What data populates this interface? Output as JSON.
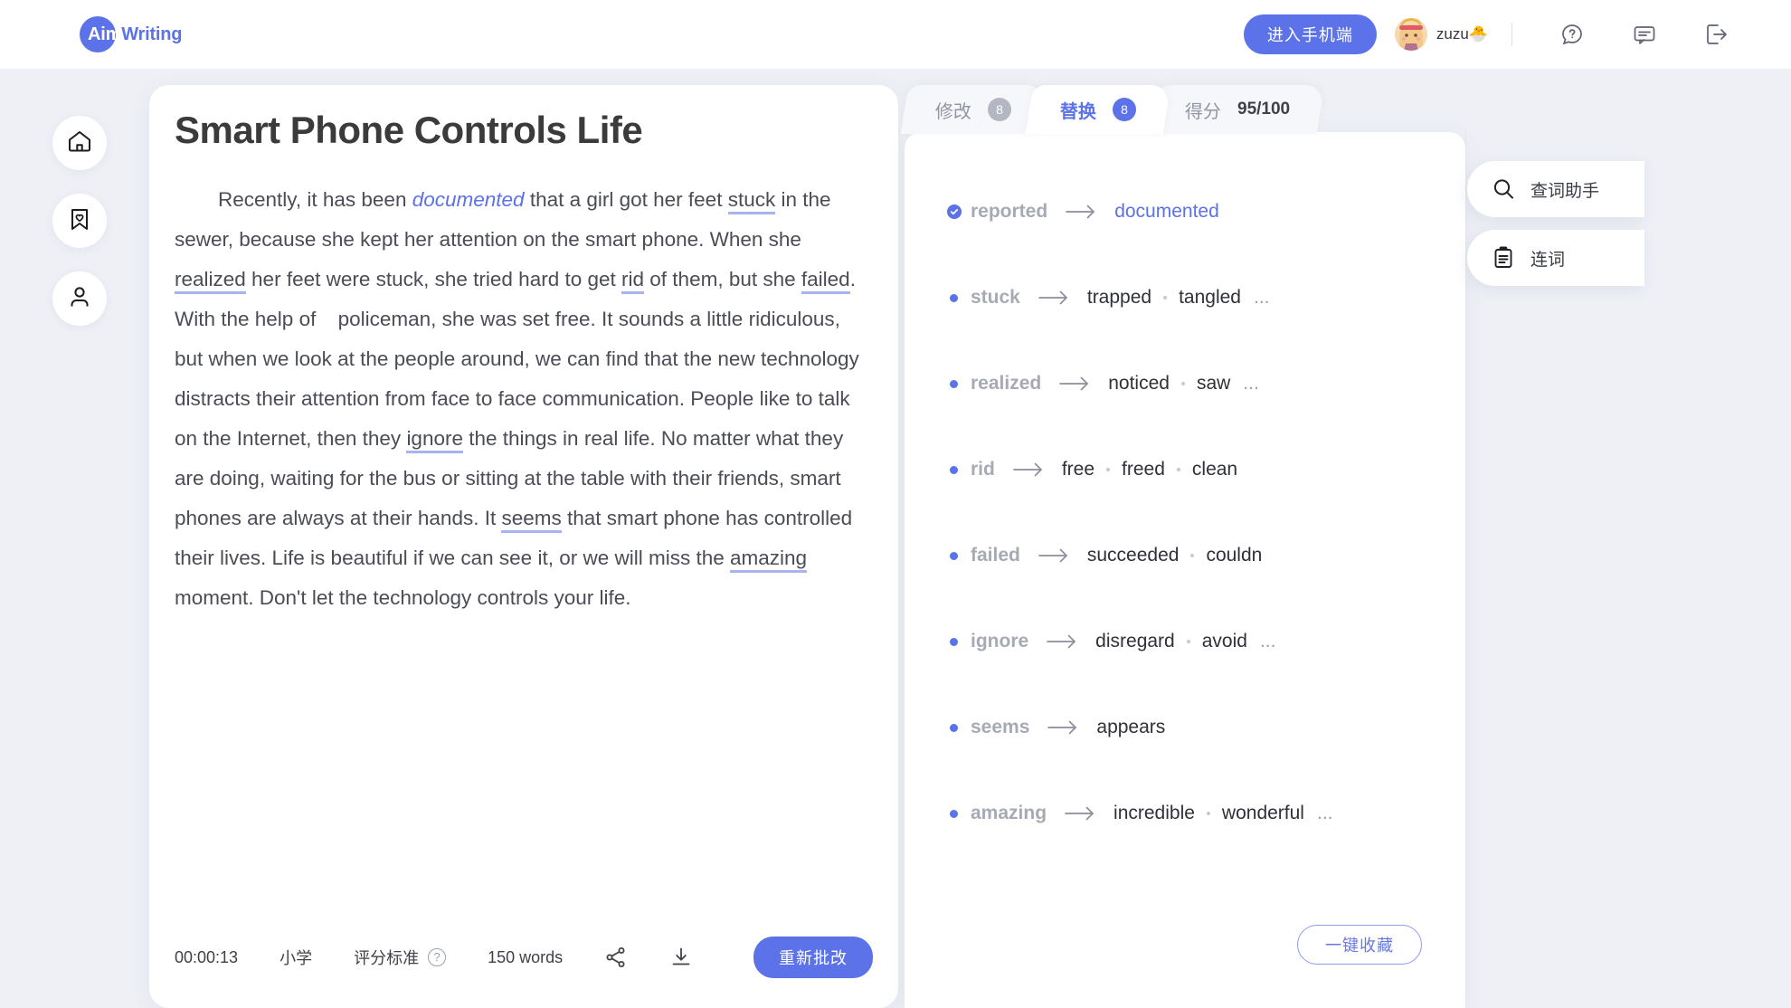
{
  "header": {
    "logo": {
      "part1": "Aim",
      "part2": "Writing"
    },
    "mobile_button": "进入手机端",
    "user_name": "zuzu🐣",
    "icons": [
      "help-icon",
      "feedback-icon",
      "logout-icon"
    ]
  },
  "sidebar": {
    "items": [
      {
        "name": "home",
        "icon": "home-icon"
      },
      {
        "name": "favorites",
        "icon": "bookmark-heart-icon"
      },
      {
        "name": "profile",
        "icon": "user-icon"
      }
    ]
  },
  "essay": {
    "title": "Smart Phone Controls Life",
    "paragraph": [
      {
        "text": "Recently, it has been ",
        "style": "normal"
      },
      {
        "text": "documented",
        "style": "replaced"
      },
      {
        "text": " that a girl got her feet ",
        "style": "normal"
      },
      {
        "text": "stuck",
        "style": "underline"
      },
      {
        "text": " in the sewer, because she kept her attention on the smart phone. When she ",
        "style": "normal"
      },
      {
        "text": "realized",
        "style": "underline"
      },
      {
        "text": " her feet were stuck, she tried hard to get ",
        "style": "normal"
      },
      {
        "text": "rid",
        "style": "underline"
      },
      {
        "text": " of them, but she ",
        "style": "normal"
      },
      {
        "text": "failed",
        "style": "underline"
      },
      {
        "text": ". With the help of",
        "style": "normal"
      },
      {
        "text": "",
        "style": "gap"
      },
      {
        "text": " policeman, she was set free. It sounds a little ridiculous, but when we look at the people around, we can find that the new technology distracts their attention from face to face communication. People like to talk on the Internet, then they ",
        "style": "normal"
      },
      {
        "text": "ignore",
        "style": "underline"
      },
      {
        "text": " the things in real life. No matter what they are doing, waiting for the bus or sitting at the table with their friends, smart phones are always at their hands. It ",
        "style": "normal"
      },
      {
        "text": "seems",
        "style": "underline"
      },
      {
        "text": " that smart phone has controlled their lives. Life is beautiful if we can see it, or we will miss the ",
        "style": "normal"
      },
      {
        "text": "amazing",
        "style": "underline"
      },
      {
        "text": " moment. Don't let the technology controls your life.",
        "style": "normal"
      }
    ],
    "footer": {
      "timer": "00:00:13",
      "level": "小学",
      "rubric": "评分标准",
      "word_count": "150 words",
      "share_icon": "share-icon",
      "download_icon": "download-icon",
      "redo_button": "重新批改"
    }
  },
  "tabs": [
    {
      "label": "修改",
      "badge": "8",
      "active": false
    },
    {
      "label": "替换",
      "badge": "8",
      "active": true
    },
    {
      "label": "得分",
      "score": "95/100",
      "active": false
    }
  ],
  "suggestions": [
    {
      "marker": "check",
      "original": "reported",
      "candidates": [
        "documented"
      ],
      "applied_index": 0,
      "more": false
    },
    {
      "marker": "dot",
      "original": "stuck",
      "candidates": [
        "trapped",
        "tangled"
      ],
      "applied_index": -1,
      "more": true
    },
    {
      "marker": "dot",
      "original": "realized",
      "candidates": [
        "noticed",
        "saw"
      ],
      "applied_index": -1,
      "more": true
    },
    {
      "marker": "dot",
      "original": "rid",
      "candidates": [
        "free",
        "freed",
        "clean"
      ],
      "applied_index": -1,
      "more": false
    },
    {
      "marker": "dot",
      "original": "failed",
      "candidates": [
        "succeeded",
        "couldn"
      ],
      "applied_index": -1,
      "more": false
    },
    {
      "marker": "dot",
      "original": "ignore",
      "candidates": [
        "disregard",
        "avoid"
      ],
      "applied_index": -1,
      "more": true
    },
    {
      "marker": "dot",
      "original": "seems",
      "candidates": [
        "appears"
      ],
      "applied_index": -1,
      "more": false
    },
    {
      "marker": "dot",
      "original": "amazing",
      "candidates": [
        "incredible",
        "wonderful"
      ],
      "applied_index": -1,
      "more": true
    }
  ],
  "panel_footer": {
    "favorite_button": "一键收藏"
  },
  "tools": [
    {
      "label": "查词助手",
      "icon": "search-icon"
    },
    {
      "label": "连词",
      "icon": "clipboard-icon"
    }
  ],
  "colors": {
    "accent": "#5b72e8",
    "page_bg": "#eef0f6",
    "underline": "#a7b4ef",
    "badge_inactive": "#b3b7c2"
  }
}
